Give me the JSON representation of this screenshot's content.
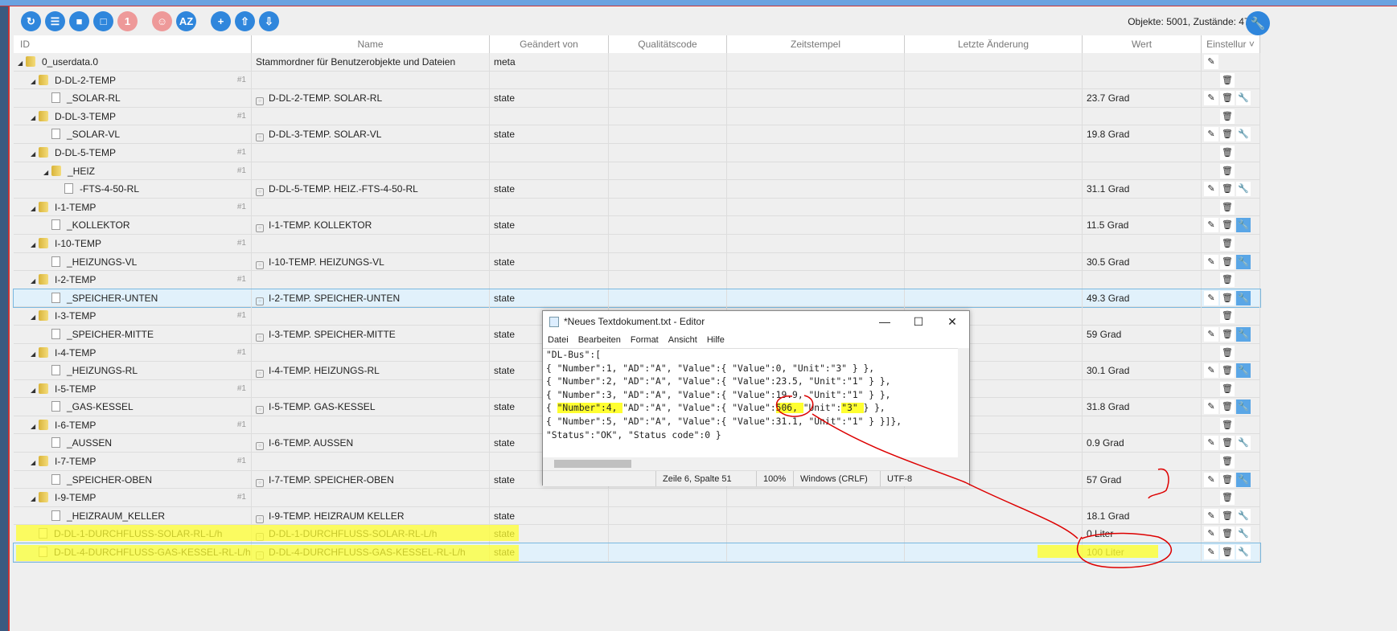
{
  "toolbar": {
    "buttons": [
      "refresh-icon",
      "list-icon",
      "folder-icon",
      "folder-open-icon",
      "one-icon",
      "user-settings-icon",
      "sort-az-icon",
      "add-icon",
      "upload-icon",
      "download-icon"
    ],
    "glyphs": [
      "↻",
      "☰",
      "■",
      "□",
      "1",
      "☺",
      "AZ",
      "+",
      "⇧",
      "⇩"
    ],
    "counts": "Objekte: 5001, Zustände: 4766"
  },
  "columns": [
    "ID",
    "Name",
    "Geändert von",
    "Qualitätscode",
    "Zeitstempel",
    "Letzte Änderung",
    "Wert",
    "Einstellur ˅"
  ],
  "rows": [
    {
      "id": "0_userdata.0",
      "type": "folder",
      "level": 0,
      "name": "Stammordner für Benutzerobjekte und Dateien",
      "from": "meta",
      "value": "",
      "actions": [
        "edit"
      ]
    },
    {
      "id": "D-DL-2-TEMP",
      "type": "folder",
      "level": 1,
      "count": "#1",
      "actions": [
        "delete"
      ]
    },
    {
      "id": "_SOLAR-RL",
      "type": "file",
      "level": 2,
      "name": "D-DL-2-TEMP. SOLAR-RL",
      "from": "state",
      "value": "23.7 Grad",
      "actions": [
        "edit",
        "delete",
        "wrench"
      ]
    },
    {
      "id": "D-DL-3-TEMP",
      "type": "folder",
      "level": 1,
      "count": "#1",
      "actions": [
        "delete"
      ]
    },
    {
      "id": "_SOLAR-VL",
      "type": "file",
      "level": 2,
      "name": "D-DL-3-TEMP. SOLAR-VL",
      "from": "state",
      "value": "19.8 Grad",
      "actions": [
        "edit",
        "delete",
        "wrench"
      ]
    },
    {
      "id": "D-DL-5-TEMP",
      "type": "folder",
      "level": 1,
      "count": "#1",
      "actions": [
        "delete"
      ]
    },
    {
      "id": "_HEIZ",
      "type": "folder",
      "level": 2,
      "count": "#1",
      "actions": [
        "delete"
      ]
    },
    {
      "id": "-FTS-4-50-RL",
      "type": "file",
      "level": 3,
      "name": "D-DL-5-TEMP. HEIZ.-FTS-4-50-RL",
      "from": "state",
      "value": "31.1 Grad",
      "actions": [
        "edit",
        "delete",
        "wrench"
      ]
    },
    {
      "id": "I-1-TEMP",
      "type": "folder",
      "level": 1,
      "count": "#1",
      "actions": [
        "delete"
      ]
    },
    {
      "id": "_KOLLEKTOR",
      "type": "file",
      "level": 2,
      "name": "I-1-TEMP. KOLLEKTOR",
      "from": "state",
      "value": "11.5 Grad",
      "actions": [
        "edit",
        "delete",
        "wrench-active"
      ]
    },
    {
      "id": "I-10-TEMP",
      "type": "folder",
      "level": 1,
      "count": "#1",
      "actions": [
        "delete"
      ]
    },
    {
      "id": "_HEIZUNGS-VL",
      "type": "file",
      "level": 2,
      "name": "I-10-TEMP. HEIZUNGS-VL",
      "from": "state",
      "value": "30.5 Grad",
      "actions": [
        "edit",
        "delete",
        "wrench-active"
      ]
    },
    {
      "id": "I-2-TEMP",
      "type": "folder",
      "level": 1,
      "count": "#1",
      "actions": [
        "delete"
      ]
    },
    {
      "id": "_SPEICHER-UNTEN",
      "type": "file",
      "level": 2,
      "name": "I-2-TEMP. SPEICHER-UNTEN",
      "from": "state",
      "value": "49.3 Grad",
      "selected": true,
      "actions": [
        "edit",
        "delete",
        "wrench-active"
      ]
    },
    {
      "id": "I-3-TEMP",
      "type": "folder",
      "level": 1,
      "count": "#1",
      "actions": [
        "delete"
      ]
    },
    {
      "id": "_SPEICHER-MITTE",
      "type": "file",
      "level": 2,
      "name": "I-3-TEMP. SPEICHER-MITTE",
      "from": "state",
      "value": "59 Grad",
      "actions": [
        "edit",
        "delete",
        "wrench-active"
      ]
    },
    {
      "id": "I-4-TEMP",
      "type": "folder",
      "level": 1,
      "count": "#1",
      "actions": [
        "delete"
      ]
    },
    {
      "id": "_HEIZUNGS-RL",
      "type": "file",
      "level": 2,
      "name": "I-4-TEMP. HEIZUNGS-RL",
      "from": "state",
      "value": "30.1 Grad",
      "actions": [
        "edit",
        "delete",
        "wrench-active"
      ]
    },
    {
      "id": "I-5-TEMP",
      "type": "folder",
      "level": 1,
      "count": "#1",
      "actions": [
        "delete"
      ]
    },
    {
      "id": "_GAS-KESSEL",
      "type": "file",
      "level": 2,
      "name": "I-5-TEMP. GAS-KESSEL",
      "from": "state",
      "value": "31.8 Grad",
      "actions": [
        "edit",
        "delete",
        "wrench-active"
      ]
    },
    {
      "id": "I-6-TEMP",
      "type": "folder",
      "level": 1,
      "count": "#1",
      "actions": [
        "delete"
      ]
    },
    {
      "id": "_AUSSEN",
      "type": "file",
      "level": 2,
      "name": "I-6-TEMP. AUSSEN",
      "from": "state",
      "value": "0.9 Grad",
      "actions": [
        "edit",
        "delete",
        "wrench"
      ]
    },
    {
      "id": "I-7-TEMP",
      "type": "folder",
      "level": 1,
      "count": "#1",
      "actions": [
        "delete"
      ]
    },
    {
      "id": "_SPEICHER-OBEN",
      "type": "file",
      "level": 2,
      "name": "I-7-TEMP. SPEICHER-OBEN",
      "from": "state",
      "value": "57 Grad",
      "actions": [
        "edit",
        "delete",
        "wrench-active"
      ]
    },
    {
      "id": "I-9-TEMP",
      "type": "folder",
      "level": 1,
      "count": "#1",
      "actions": [
        "delete"
      ]
    },
    {
      "id": "_HEIZRAUM_KELLER",
      "type": "file",
      "level": 2,
      "name": "I-9-TEMP. HEIZRAUM KELLER",
      "from": "state",
      "value": "18.1 Grad",
      "actions": [
        "edit",
        "delete",
        "wrench"
      ]
    },
    {
      "id": "D-DL-1-DURCHFLUSS-SOLAR-RL-L/h",
      "type": "file",
      "level": 1,
      "name": "D-DL-1-DURCHFLUSS-SOLAR-RL-L/h",
      "from": "state",
      "value": "0 Liter",
      "actions": [
        "edit",
        "delete",
        "wrench"
      ]
    },
    {
      "id": "D-DL-4-DURCHFLUSS-GAS-KESSEL-RL-L/h",
      "type": "file",
      "level": 1,
      "name": "D-DL-4-DURCHFLUSS-GAS-KESSEL-RL-L/h",
      "from": "state",
      "value": "100 Liter",
      "selected": true,
      "actions": [
        "edit",
        "delete",
        "wrench"
      ]
    }
  ],
  "editor": {
    "title": "*Neues Textdokument.txt - Editor",
    "controls": [
      "—",
      "☐",
      "✕"
    ],
    "menu": [
      "Datei",
      "Bearbeiten",
      "Format",
      "Ansicht",
      "Hilfe"
    ],
    "lines": [
      "\"DL-Bus\":[",
      "{ \"Number\":1, \"AD\":\"A\", \"Value\":{ \"Value\":0, \"Unit\":\"3\" } },",
      "{ \"Number\":2, \"AD\":\"A\", \"Value\":{ \"Value\":23.5, \"Unit\":\"1\" } },",
      "{ \"Number\":3, \"AD\":\"A\", \"Value\":{ \"Value\":19.9, \"Unit\":\"1\" } },",
      "{ \"Number\":4, \"AD\":\"A\", \"Value\":{ \"Value\":506, \"Unit\":\"3\" } },",
      "{ \"Number\":5, \"AD\":\"A\", \"Value\":{ \"Value\":31.1, \"Unit\":\"1\" } }]},",
      "\"Status\":\"OK\", \"Status code\":0 }"
    ],
    "status": {
      "position": "Zeile 6, Spalte 51",
      "zoom": "100%",
      "line_ending": "Windows (CRLF)",
      "encoding": "UTF-8"
    }
  },
  "colors": {
    "accent": "#2f86dc",
    "highlight": "#ffff30",
    "annotation": "#d00000"
  }
}
